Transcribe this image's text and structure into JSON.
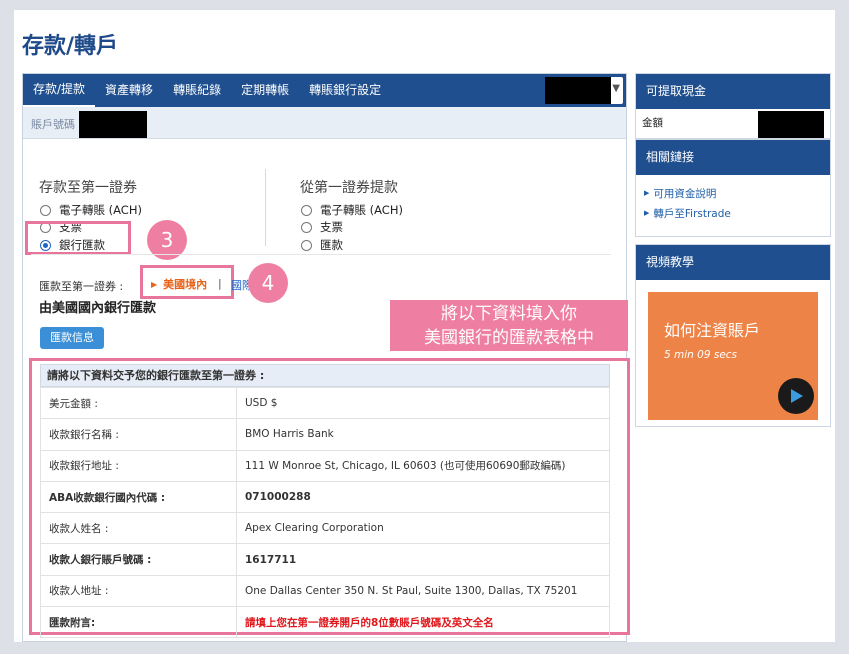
{
  "page_title": "存款/轉戶",
  "nav": {
    "tabs": [
      "存款/提款",
      "資產轉移",
      "轉賬紀錄",
      "定期轉帳",
      "轉賬銀行設定"
    ],
    "active_tab": 0
  },
  "account": {
    "label": "賬戶號碼 :"
  },
  "deposit": {
    "title": "存款至第一證券",
    "options": [
      "電子轉賬 (ACH)",
      "支票",
      "銀行匯款"
    ],
    "selected": 2
  },
  "withdraw": {
    "title": "從第一證券提款",
    "options": [
      "電子轉賬 (ACH)",
      "支票",
      "匯款"
    ]
  },
  "steps": {
    "three": "3",
    "four": "4"
  },
  "wire": {
    "to_label": "匯款至第一證券 :",
    "domestic_label": "美國境內",
    "separator": "|",
    "international_label": "國際",
    "heading": "由美國國內銀行匯款",
    "info_button": "匯款信息"
  },
  "banner": {
    "line1": "將以下資料填入你",
    "line2": "美國銀行的匯款表格中"
  },
  "info_table": {
    "heading": "請將以下資料交予您的銀行匯款至第一證券 :",
    "rows": [
      {
        "key": "美元金額 :",
        "value": "USD $"
      },
      {
        "key": "收款銀行名稱 :",
        "value": "BMO Harris Bank"
      },
      {
        "key": "收款銀行地址 :",
        "value": "111 W Monroe St, Chicago, IL 60603 (也可使用60690郵政編碼)"
      },
      {
        "key": "ABA收款銀行國內代碼 :",
        "value": "071000288"
      },
      {
        "key": "收款人姓名 :",
        "value": "Apex Clearing Corporation"
      },
      {
        "key": "收款人銀行賬戶號碼 :",
        "value": "1617711"
      },
      {
        "key": "收款人地址 :",
        "value": "One Dallas Center 350 N. St Paul, Suite 1300, Dallas, TX 75201"
      },
      {
        "key": "匯款附言:",
        "value": "請填上您在第一證券開戶的8位數賬戶號碼及英文全名"
      }
    ]
  },
  "sidebar": {
    "cash": {
      "title": "可提取現金",
      "amount_label": "金額"
    },
    "links": {
      "title": "相關鏈接",
      "items": [
        "可用資金說明",
        "轉戶至Firstrade"
      ]
    },
    "video": {
      "title": "視頻教學",
      "card_title": "如何注資賬戶",
      "duration": "5 min 09 secs"
    }
  },
  "colors": {
    "brand_blue": "#1f4f8f",
    "highlight_pink": "#e7769a",
    "accent_orange": "#ee8347",
    "warning_red": "#e0161b"
  }
}
